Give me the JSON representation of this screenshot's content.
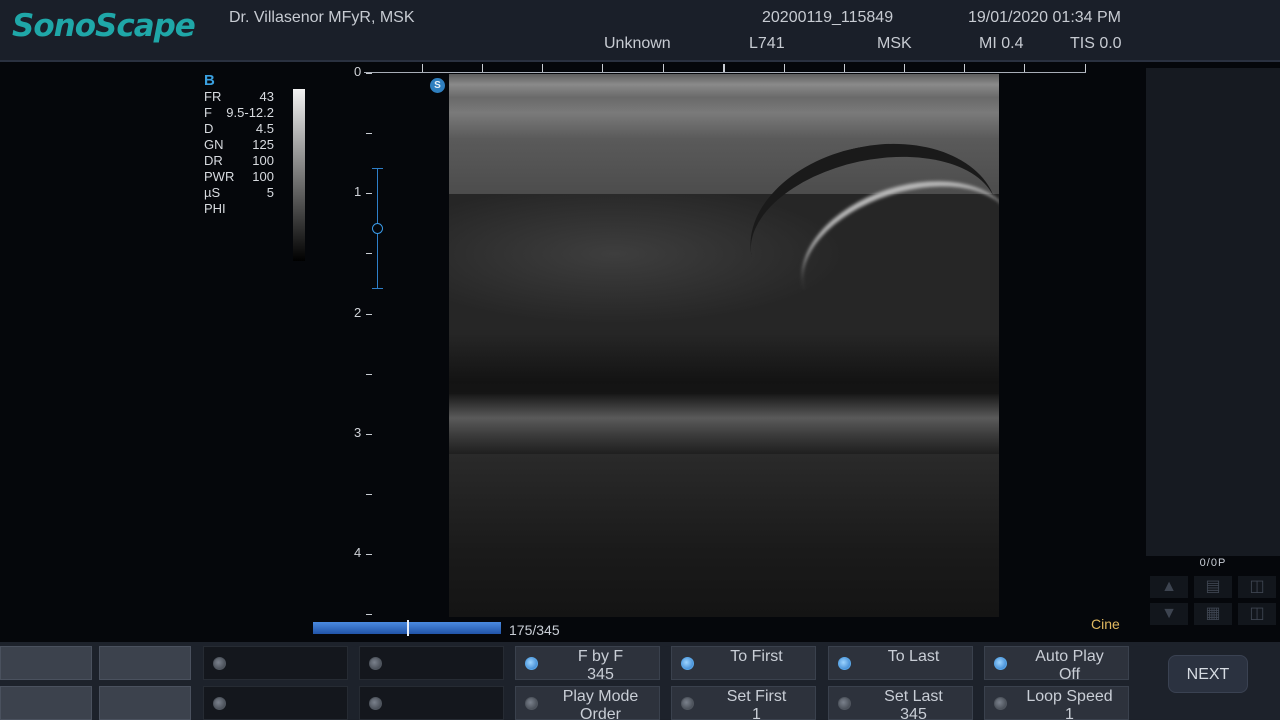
{
  "header": {
    "logo": "SonoScape",
    "operator": "Dr. Villasenor MFyR, MSK",
    "exam_id": "20200119_115849",
    "datetime": "19/01/2020 01:34 PM",
    "patient": "Unknown",
    "probe": "L741",
    "preset": "MSK",
    "mi": "MI 0.4",
    "tis": "TIS 0.0"
  },
  "params": {
    "mode": "B",
    "rows": [
      {
        "key": "FR",
        "value": "43"
      },
      {
        "key": "F",
        "value": "9.5-12.2"
      },
      {
        "key": "D",
        "value": "4.5"
      },
      {
        "key": "GN",
        "value": "125"
      },
      {
        "key": "DR",
        "value": "100"
      },
      {
        "key": "PWR",
        "value": "100"
      },
      {
        "key": "µS",
        "value": "5"
      },
      {
        "key": "PHI",
        "value": ""
      }
    ]
  },
  "depth_scale": {
    "labels": [
      "0",
      "1",
      "2",
      "3",
      "4"
    ]
  },
  "image": {
    "orientation_marker": "S"
  },
  "cine": {
    "frames": "175/345",
    "current_frame": 175,
    "total_frames": 345,
    "label": "Cine"
  },
  "thumbnails": {
    "counter": "0/0P"
  },
  "icons": {
    "up": "triangle-up-icon",
    "down": "triangle-down-icon",
    "report": "report-icon",
    "delete": "trash-icon",
    "export": "export-icon",
    "send": "send-icon"
  },
  "controls": {
    "f_by_f": {
      "label": "F by F",
      "value": "345"
    },
    "to_first": {
      "label": "To First"
    },
    "to_last": {
      "label": "To Last"
    },
    "auto_play": {
      "label": "Auto Play",
      "value": "Off"
    },
    "play_mode": {
      "label": "Play Mode",
      "value": "Order"
    },
    "set_first": {
      "label": "Set First",
      "value": "1"
    },
    "set_last": {
      "label": "Set Last",
      "value": "345"
    },
    "loop_speed": {
      "label": "Loop Speed",
      "value": "1"
    },
    "next": "NEXT"
  }
}
